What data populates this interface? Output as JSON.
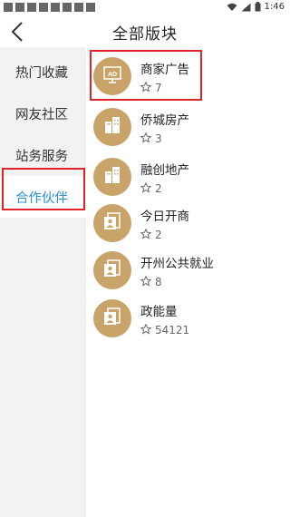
{
  "status_bar": {
    "time": "1:46"
  },
  "header": {
    "title": "全部版块"
  },
  "sidebar": {
    "items": [
      {
        "label": "热门收藏"
      },
      {
        "label": "网友社区"
      },
      {
        "label": "站务服务"
      },
      {
        "label": "合作伙伴"
      }
    ],
    "active_index": 3
  },
  "boards": [
    {
      "title": "商家广告",
      "count": "7",
      "icon": "ad-icon"
    },
    {
      "title": "侨城房产",
      "count": "3",
      "icon": "building-icon"
    },
    {
      "title": "融创地产",
      "count": "2",
      "icon": "building-icon"
    },
    {
      "title": "今日开商",
      "count": "2",
      "icon": "profile-icon"
    },
    {
      "title": "开州公共就业",
      "count": "8",
      "icon": "profile-icon"
    },
    {
      "title": "政能量",
      "count": "54121",
      "icon": "profile-icon"
    }
  ],
  "ad_icon_text": "AD",
  "colors": {
    "accent": "#2a8fd8",
    "avatar_bg": "#c9a46a",
    "highlight": "#e0232b",
    "sidebar_bg": "#f2f2f2"
  }
}
